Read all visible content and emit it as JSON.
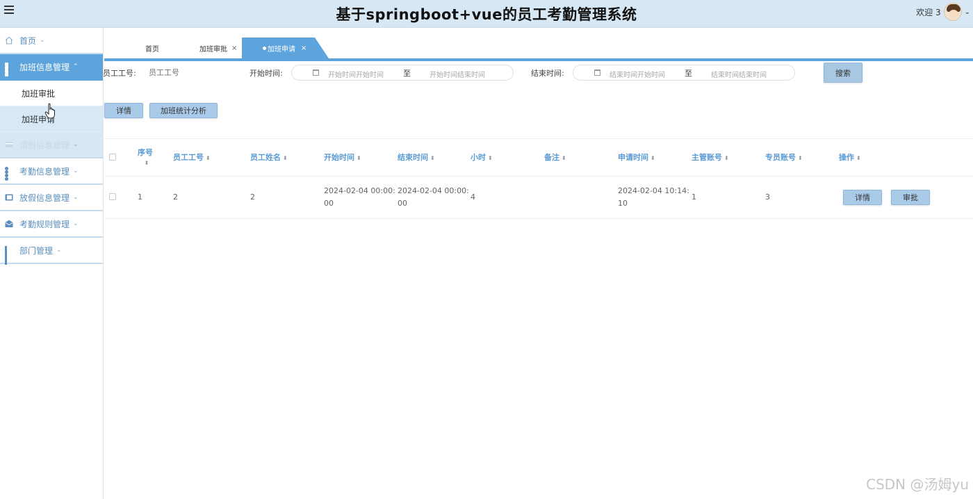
{
  "header": {
    "title": "基于springboot+vue的员工考勤管理系统",
    "welcome": "欢迎 3",
    "user_caret": "⌄"
  },
  "sidebar": {
    "items": [
      {
        "label": "首页",
        "icon": "home-icon",
        "caret": "⌄"
      },
      {
        "label": "加班信息管理",
        "icon": "grid-icon",
        "caret": "⌃"
      },
      {
        "label": "加班审批"
      },
      {
        "label": "加班申请"
      },
      {
        "label": "请假信息管理",
        "icon": "card-icon",
        "caret": "⌄"
      },
      {
        "label": "考勤信息管理",
        "icon": "dots-icon",
        "caret": "⌄"
      },
      {
        "label": "放假信息管理",
        "icon": "panel-icon",
        "caret": "⌄"
      },
      {
        "label": "考勤规则管理",
        "icon": "mail-icon",
        "caret": "⌄"
      },
      {
        "label": "部门管理",
        "icon": "apps-icon",
        "caret": "⌄"
      }
    ]
  },
  "tabs": [
    {
      "label": "首页",
      "close": ""
    },
    {
      "label": "加班审批",
      "close": "×"
    },
    {
      "label": "加班申请",
      "close": "×",
      "active": true
    }
  ],
  "filters": {
    "employee_no_label": "员工工号:",
    "employee_no_placeholder": "员工工号",
    "start_time_label": "开始时间:",
    "start_from_placeholder": "开始时间开始时间",
    "range_sep": "至",
    "start_to_placeholder": "开始时间结束时间",
    "end_time_label": "结束时间:",
    "end_from_placeholder": "结束时间开始时间",
    "end_to_placeholder": "结束时间结束时间",
    "search_button": "搜索"
  },
  "actions": {
    "detail_button": "详情",
    "stats_button": "加班统计分析"
  },
  "table": {
    "columns": [
      "序号",
      "员工工号",
      "员工姓名",
      "开始时间",
      "结束时间",
      "小时",
      "备注",
      "申请时间",
      "主管账号",
      "专员账号",
      "操作"
    ],
    "sort_glyph": "⬍",
    "rows": [
      {
        "index": "1",
        "employee_no": "2",
        "employee_name": "2",
        "start_time_l1": "2024-02-04 00:00:",
        "start_time_l2": "00",
        "end_time_l1": "2024-02-04 00:00:",
        "end_time_l2": "00",
        "hours": "4",
        "remark": "",
        "apply_time_l1": "2024-02-04 10:14:",
        "apply_time_l2": "10",
        "manager_account": "1",
        "specialist_account": "3",
        "detail_label": "详情",
        "approve_label": "审批"
      }
    ]
  },
  "watermark": "CSDN @汤姆yu",
  "colors": {
    "accent": "#5da3dc",
    "header_bg": "#d7e7f4",
    "button_bg": "#a9cbe9"
  }
}
